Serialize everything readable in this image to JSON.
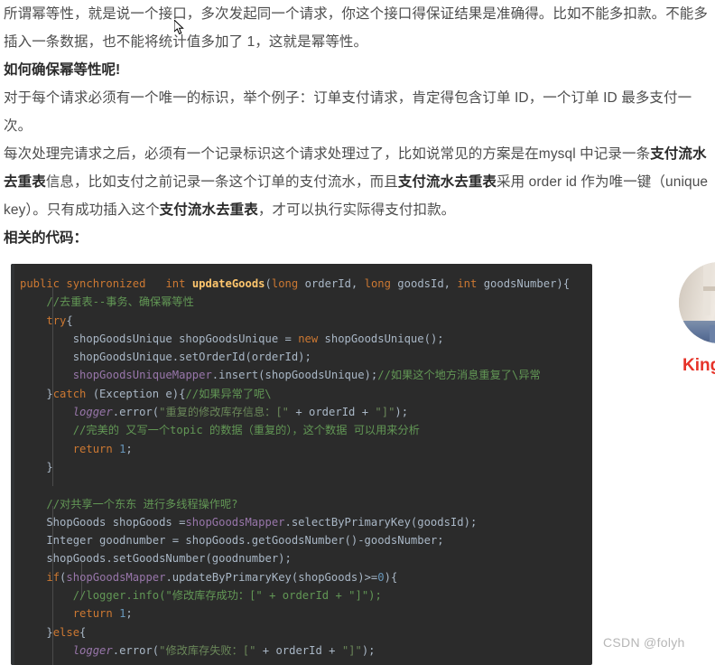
{
  "article": {
    "paragraphs": [
      {
        "id": "p1",
        "text": "所谓幂等性，就是说一个接口，多次发起同一个请求，你这个接口得保证结果是准确得。比如不能多扣款。不能多插入一条数据，也不能将统计值多加了 1，这就是幂等性。"
      },
      {
        "id": "h1",
        "text": "如何确保幂等性呢!"
      },
      {
        "id": "p2",
        "text": "对于每个请求必须有一个唯一的标识，举个例子：订单支付请求，肯定得包含订单 ID，一个订单 ID 最多支付一次。"
      },
      {
        "id": "p3a",
        "text": "每次处理完请求之后，必须有一个记录标识这个请求处理过了，比如说常见的方案是在mysql 中记录一条"
      },
      {
        "id": "p3b_bold",
        "text": "支付流水去重表"
      },
      {
        "id": "p3c",
        "text": "信息，比如支付之前记录一条这个订单的支付流水，而且"
      },
      {
        "id": "p3d_bold",
        "text": "支付流水去重表"
      },
      {
        "id": "p3e",
        "text": "采用 order id 作为唯一键（unique key）。只有成功插入这个"
      },
      {
        "id": "p3f_bold",
        "text": "支付流水去重表"
      },
      {
        "id": "p3g",
        "text": "，才可以执行实际得支付扣款。"
      },
      {
        "id": "h2",
        "text": "相关的代码："
      }
    ]
  },
  "code": {
    "language": "java",
    "lines": [
      "public synchronized   int updateGoods(long orderId, long goodsId, int goodsNumber){",
      "    //去重表--事务、确保幂等性",
      "    try{",
      "        shopGoodsUnique shopGoodsUnique = new shopGoodsUnique();",
      "        shopGoodsUnique.setOrderId(orderId);",
      "        shopGoodsUniqueMapper.insert(shopGoodsUnique);//如果这个地方消息重复了\\异常",
      "    }catch (Exception e){//如果异常了呢\\",
      "        logger.error(\"重复的修改库存信息：[\" + orderId + \"]\");",
      "        //完美的 又写一个topic 的数据（重复的），这个数据 可以用来分析",
      "        return 1;",
      "    }",
      "",
      "    //对共享一个东东 进行多线程操作呢?",
      "    ShopGoods shopGoods =shopGoodsMapper.selectByPrimaryKey(goodsId);",
      "    Integer goodnumber = shopGoods.getGoodsNumber()-goodsNumber;",
      "    shopGoods.setGoodsNumber(goodnumber);",
      "    if(shopGoodsMapper.updateByPrimaryKey(shopGoods)>=0){",
      "        //logger.info(\"修改库存成功：[\" + orderId + \"]\");",
      "        return 1;",
      "    }else{",
      "        logger.error(\"修改库存失败：[\" + orderId + \"]\");"
    ],
    "colors": {
      "background": "#2b2b2b",
      "default_text": "#a9b7c6",
      "keyword": "#cc7832",
      "method": "#ffc66d",
      "field": "#9876aa",
      "comment": "#629755",
      "string": "#6a8759",
      "number": "#6897bb"
    }
  },
  "author": {
    "nickname": "King",
    "nickname_color": "#e63329",
    "avatar_alt": "avatar-photo"
  },
  "watermark": {
    "text": "CSDN @folyh"
  }
}
